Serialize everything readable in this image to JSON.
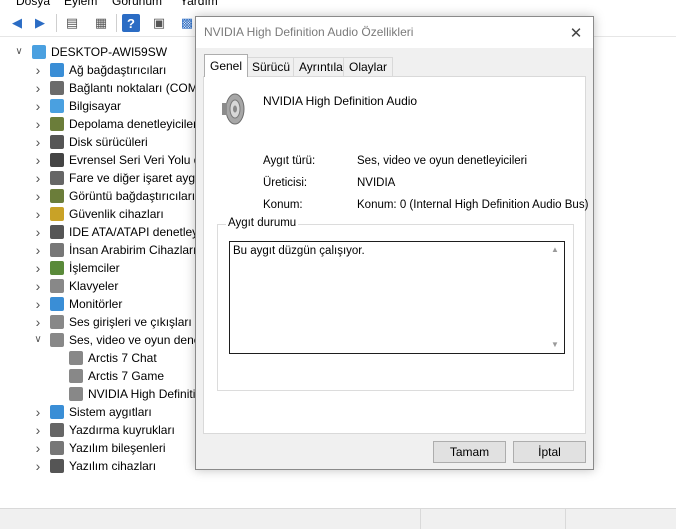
{
  "menu": [
    "Dosya",
    "Eylem",
    "Görünüm",
    "Yardım"
  ],
  "tree": {
    "root": "DESKTOP-AWI59SW",
    "items": [
      {
        "label": "Ağ bağdaştırıcıları",
        "icon": "network-adapter-icon",
        "color": "#3a8ed6"
      },
      {
        "label": "Bağlantı noktaları (COM",
        "icon": "port-icon",
        "color": "#6b6b6b"
      },
      {
        "label": "Bilgisayar",
        "icon": "computer-icon",
        "color": "#4aa0e0"
      },
      {
        "label": "Depolama denetleyiciler",
        "icon": "storage-icon",
        "color": "#6b7d3a"
      },
      {
        "label": "Disk sürücüleri",
        "icon": "disk-drive-icon",
        "color": "#555555"
      },
      {
        "label": "Evrensel Seri Veri Yolu de",
        "icon": "usb-icon",
        "color": "#444444"
      },
      {
        "label": "Fare ve diğer işaret aygıt",
        "icon": "mouse-icon",
        "color": "#666666"
      },
      {
        "label": "Görüntü bağdaştırıcıları",
        "icon": "display-adapter-icon",
        "color": "#6b7d3a"
      },
      {
        "label": "Güvenlik cihazları",
        "icon": "security-key-icon",
        "color": "#c9a227"
      },
      {
        "label": "IDE ATA/ATAPI denetleyi",
        "icon": "ide-icon",
        "color": "#555555"
      },
      {
        "label": "İnsan Arabirim Cihazları",
        "icon": "hid-icon",
        "color": "#777777"
      },
      {
        "label": "İşlemciler",
        "icon": "processor-icon",
        "color": "#5a8a3a"
      },
      {
        "label": "Klavyeler",
        "icon": "keyboard-icon",
        "color": "#888888"
      },
      {
        "label": "Monitörler",
        "icon": "monitor-icon",
        "color": "#3a8ed6"
      },
      {
        "label": "Ses girişleri ve çıkışları",
        "icon": "speaker-icon",
        "color": "#888888"
      },
      {
        "label": "Ses, video ve oyun dene",
        "icon": "speaker-icon",
        "color": "#888888",
        "expanded": true
      },
      {
        "label": "Arctis 7 Chat",
        "icon": "speaker-icon",
        "color": "#888888",
        "child": true
      },
      {
        "label": "Arctis 7 Game",
        "icon": "speaker-icon",
        "color": "#888888",
        "child": true
      },
      {
        "label": "NVIDIA High Definiti",
        "icon": "speaker-icon",
        "color": "#888888",
        "child": true
      },
      {
        "label": "Sistem aygıtları",
        "icon": "system-device-icon",
        "color": "#3a8ed6"
      },
      {
        "label": "Yazdırma kuyrukları",
        "icon": "printer-icon",
        "color": "#666666"
      },
      {
        "label": "Yazılım bileşenleri",
        "icon": "software-component-icon",
        "color": "#777777"
      },
      {
        "label": "Yazılım cihazları",
        "icon": "software-device-icon",
        "color": "#555555"
      }
    ]
  },
  "dialog": {
    "title": "NVIDIA High Definition Audio Özellikleri",
    "tabs": [
      "Genel",
      "Sürücü",
      "Ayrıntılar",
      "Olaylar"
    ],
    "device_name": "NVIDIA High Definition Audio",
    "props": {
      "type_label": "Aygıt türü:",
      "type_value": "Ses, video ve oyun denetleyicileri",
      "maker_label": "Üreticisi:",
      "maker_value": "NVIDIA",
      "location_label": "Konum:",
      "location_value": "Konum: 0 (Internal High Definition Audio Bus)"
    },
    "status_group_label": "Aygıt durumu",
    "status_text": "Bu aygıt düzgün çalışıyor.",
    "ok_label": "Tamam",
    "cancel_label": "İptal"
  }
}
